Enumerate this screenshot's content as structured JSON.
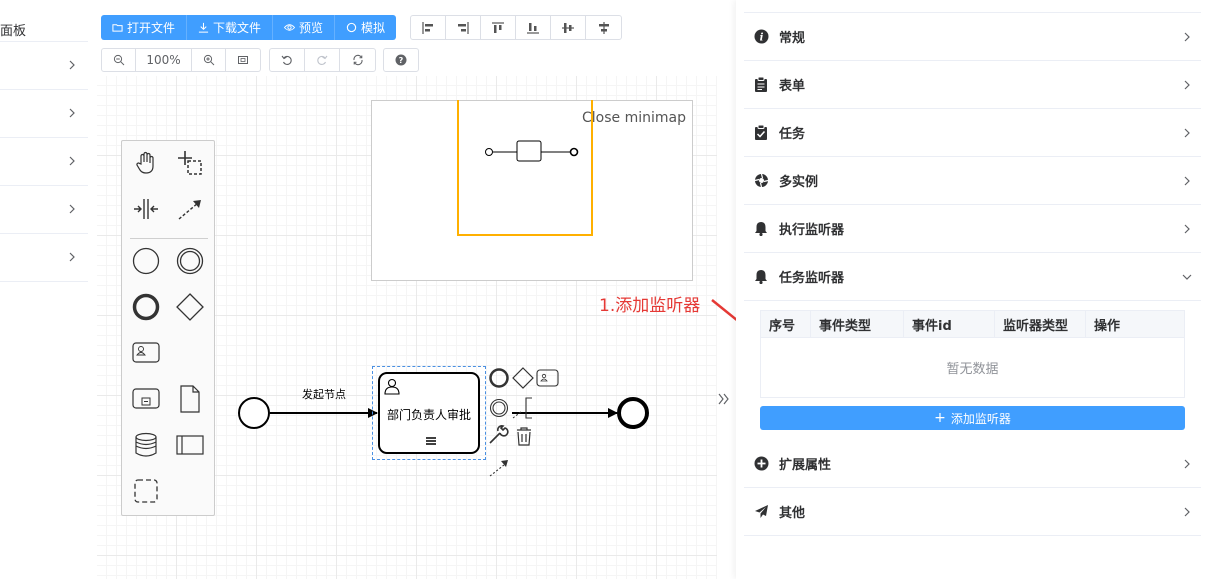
{
  "left_panel": {
    "title": "面板",
    "row_count": 5
  },
  "toolbar": {
    "open_file": "打开文件",
    "download_file": "下载文件",
    "preview": "预览",
    "simulate": "模拟",
    "zoom_level": "100%"
  },
  "minimap": {
    "close_label": "Close minimap"
  },
  "diagram": {
    "flow_label": "发起节点",
    "task_label": "部门负责人审批"
  },
  "annotation": {
    "text": "1.添加监听器"
  },
  "properties": {
    "sections": [
      {
        "label": "常规",
        "icon": "info-icon"
      },
      {
        "label": "表单",
        "icon": "clipboard-icon"
      },
      {
        "label": "任务",
        "icon": "checklist-icon"
      },
      {
        "label": "多实例",
        "icon": "aperture-icon"
      },
      {
        "label": "执行监听器",
        "icon": "bell-icon"
      },
      {
        "label": "任务监听器",
        "icon": "bell-icon",
        "expanded": true
      },
      {
        "label": "扩展属性",
        "icon": "plus-circle-icon"
      },
      {
        "label": "其他",
        "icon": "paper-plane-icon"
      }
    ],
    "listener_table": {
      "headers": [
        "序号",
        "事件类型",
        "事件id",
        "监听器类型",
        "操作"
      ],
      "empty_text": "暂无数据"
    },
    "add_listener": "添加监听器"
  },
  "colors": {
    "primary": "#409eff",
    "annotation": "#e53935",
    "minimap_viewport": "#ffb000"
  }
}
